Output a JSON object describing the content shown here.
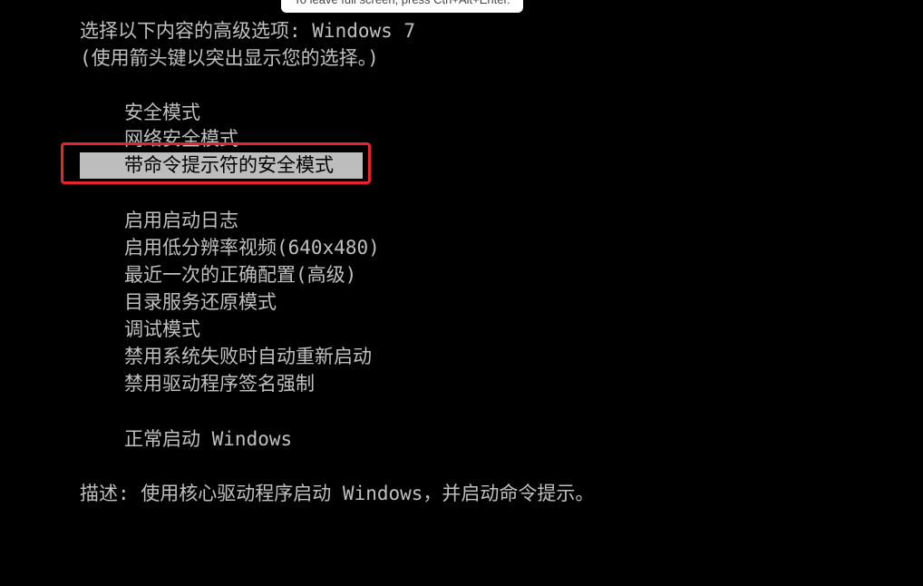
{
  "screen": {
    "title": "选择以下内容的高级选项: Windows 7",
    "instruction": "(使用箭头键以突出显示您的选择。)"
  },
  "menu": {
    "items": [
      {
        "label": "安全模式"
      },
      {
        "label": "网络安全模式"
      },
      {
        "label": "带命令提示符的安全模式",
        "selected": true
      },
      {
        "label": "启用启动日志"
      },
      {
        "label": "启用低分辨率视频(640x480)"
      },
      {
        "label": "最近一次的正确配置(高级)"
      },
      {
        "label": "目录服务还原模式"
      },
      {
        "label": "调试模式"
      },
      {
        "label": "禁用系统失败时自动重新启动"
      },
      {
        "label": "禁用驱动程序签名强制"
      },
      {
        "label": "正常启动 Windows"
      }
    ]
  },
  "description": "描述: 使用核心驱动程序启动 Windows，并启动命令提示。",
  "tooltip": {
    "text": "To leave full screen, press Ctrl+Alt+Enter."
  },
  "colors": {
    "background": "#000000",
    "text": "#c0c0c0",
    "selection": "#bdbdbd",
    "annotation_box": "#e8232b"
  }
}
